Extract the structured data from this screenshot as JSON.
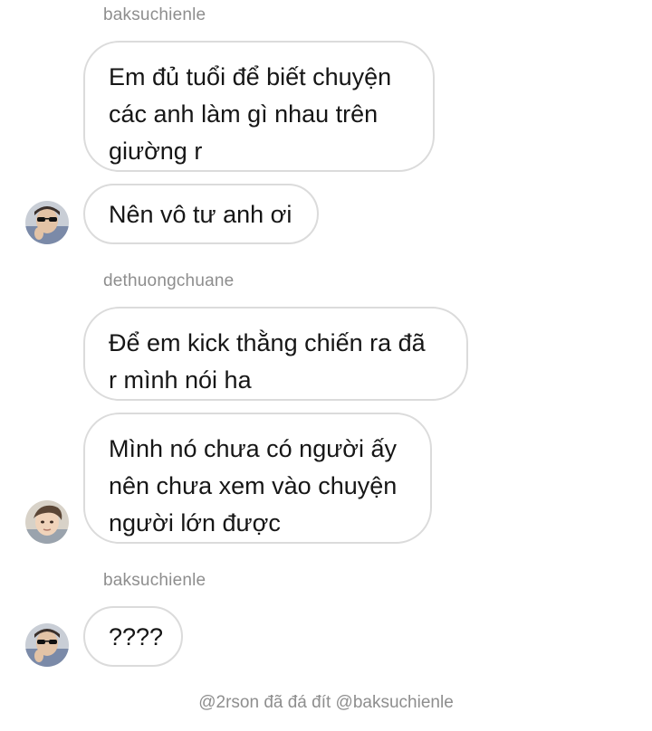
{
  "messages": [
    {
      "sender": "baksuchienle",
      "bubbles": [
        {
          "lines": [
            "Em đủ tuổi để biết chuyện",
            "các anh làm gì nhau trên",
            "giường r"
          ]
        },
        {
          "lines": [
            "Nên vô tư anh ơi"
          ]
        }
      ]
    },
    {
      "sender": "dethuongchuane",
      "bubbles": [
        {
          "lines": [
            "Để em kick thằng chiến ra đã",
            "r mình nói ha"
          ]
        },
        {
          "lines": [
            "Mình nó chưa có người ấy",
            "nên chưa xem vào chuyện",
            "người lớn được"
          ]
        }
      ]
    },
    {
      "sender": "baksuchienle",
      "bubbles": [
        {
          "lines": [
            "????"
          ]
        }
      ]
    }
  ],
  "system_notice": "@2rson đã đá đít @baksuchienle",
  "avatars": [
    {
      "user": "baksuchienle",
      "icon": "avatar-sunglasses-icon"
    },
    {
      "user": "dethuongchuane",
      "icon": "avatar-face-icon"
    },
    {
      "user": "baksuchienle",
      "icon": "avatar-sunglasses-icon"
    }
  ],
  "colors": {
    "bubble_border": "#dbdbdb",
    "meta_text": "#8e8e8e",
    "message_text": "#161616",
    "background": "#ffffff"
  }
}
